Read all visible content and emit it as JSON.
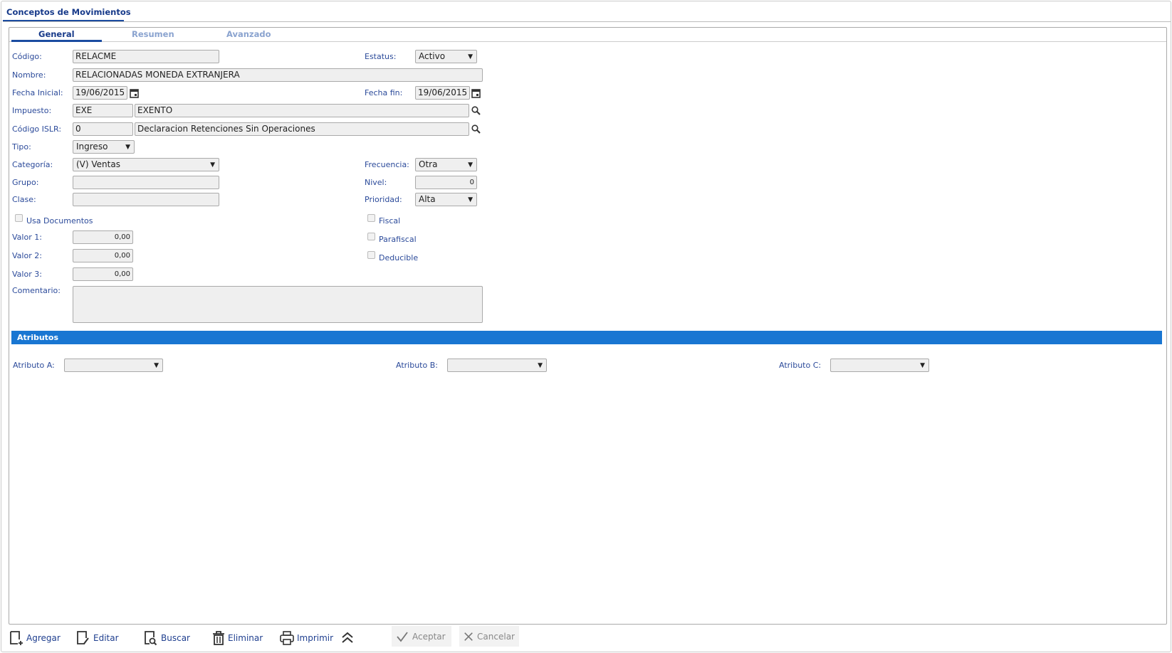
{
  "window": {
    "title": "Conceptos de Movimientos"
  },
  "tabs": [
    {
      "label": "General"
    },
    {
      "label": "Resumen"
    },
    {
      "label": "Avanzado"
    }
  ],
  "form": {
    "codigo": {
      "label": "Código:",
      "value": "RELACME"
    },
    "estatus": {
      "label": "Estatus:",
      "value": "Activo"
    },
    "nombre": {
      "label": "Nombre:",
      "value": "RELACIONADAS MONEDA EXTRANJERA"
    },
    "fecha_inicial": {
      "label": "Fecha Inicial:",
      "value": "19/06/2015"
    },
    "fecha_fin": {
      "label": "Fecha fin:",
      "value": "19/06/2015"
    },
    "impuesto": {
      "label": "Impuesto:",
      "code": "EXE",
      "description": "EXENTO"
    },
    "codigo_islr": {
      "label": "Código ISLR:",
      "code": "0",
      "description": "Declaracion Retenciones Sin Operaciones"
    },
    "tipo": {
      "label": "Tipo:",
      "value": "Ingreso"
    },
    "categoria": {
      "label": "Categoría:",
      "value": "(V) Ventas"
    },
    "frecuencia": {
      "label": "Frecuencia:",
      "value": "Otra"
    },
    "grupo": {
      "label": "Grupo:",
      "value": ""
    },
    "nivel": {
      "label": "Nivel:",
      "value": "0"
    },
    "clase": {
      "label": "Clase:",
      "value": ""
    },
    "prioridad": {
      "label": "Prioridad:",
      "value": "Alta"
    },
    "usa_documentos": {
      "label": "Usa Documentos",
      "checked": false
    },
    "fiscal": {
      "label": "Fiscal",
      "checked": false
    },
    "parafiscal": {
      "label": "Parafiscal",
      "checked": false
    },
    "deducible": {
      "label": "Deducible",
      "checked": false
    },
    "valor1": {
      "label": "Valor 1:",
      "value": "0,00"
    },
    "valor2": {
      "label": "Valor 2:",
      "value": "0,00"
    },
    "valor3": {
      "label": "Valor 3:",
      "value": "0,00"
    },
    "comentario": {
      "label": "Comentario:",
      "value": ""
    }
  },
  "atributos": {
    "title": "Atributos",
    "a": {
      "label": "Atributo A:",
      "value": ""
    },
    "b": {
      "label": "Atributo B:",
      "value": ""
    },
    "c": {
      "label": "Atributo C:",
      "value": ""
    }
  },
  "toolbar": {
    "agregar": "Agregar",
    "editar": "Editar",
    "buscar": "Buscar",
    "eliminar": "Eliminar",
    "imprimir": "Imprimir",
    "aceptar": "Aceptar",
    "cancelar": "Cancelar"
  },
  "colors": {
    "accent": "#1976d2",
    "label": "#2b4a9a",
    "title": "#173a8a"
  }
}
